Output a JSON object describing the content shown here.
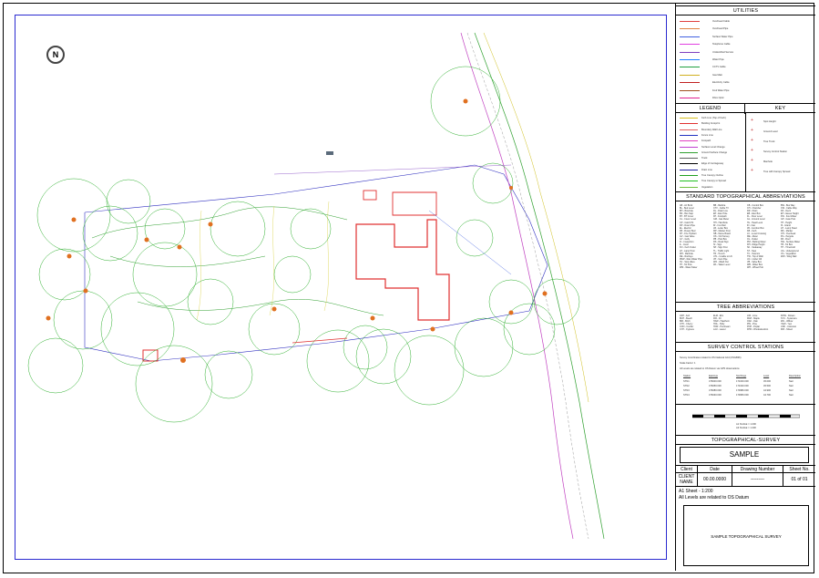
{
  "north_label": "N",
  "panel": {
    "utilities_title": "UTILITIES",
    "utilities": [
      {
        "label": "Overhead Cable",
        "color": "#e04040"
      },
      {
        "label": "Overhead Pipe",
        "color": "#e08040"
      },
      {
        "label": "Surface Water Pipe",
        "color": "#4060e0"
      },
      {
        "label": "Telephone Cable",
        "color": "#e040e0"
      },
      {
        "label": "Unidentified Service",
        "color": "#8040c0"
      },
      {
        "label": "Water Pipe",
        "color": "#2080ff"
      },
      {
        "label": "CCTV Cable",
        "color": "#20a040"
      },
      {
        "label": "Gas Main",
        "color": "#d0b020"
      },
      {
        "label": "Electricity Cable",
        "color": "#c02020"
      },
      {
        "label": "Foul Water Pipe",
        "color": "#a05020"
      },
      {
        "label": "Fibre Optic",
        "color": "#e02090"
      }
    ],
    "legend_title": "LEGEND",
    "key_title": "KEY",
    "legend_items": [
      {
        "label": "Kerb Line (Top of Kerb)",
        "color": "#d8c020"
      },
      {
        "label": "Building Footprint",
        "color": "#e03030"
      },
      {
        "label": "Boundary Wall Line",
        "color": "#e06060"
      },
      {
        "label": "Fence Line",
        "color": "#2030c0"
      },
      {
        "label": "Footpath",
        "color": "#e040c0"
      },
      {
        "label": "Surface Level Change",
        "color": "#c040d0"
      },
      {
        "label": "Ground Surface Change",
        "color": "#30a030"
      },
      {
        "label": "Track",
        "color": "#606060"
      },
      {
        "label": "Edge of Carriageway",
        "color": "#000000"
      },
      {
        "label": "Drain Line",
        "color": "#2020a0"
      },
      {
        "label": "Tree Canopy Outline",
        "color": "#20a020"
      },
      {
        "label": "Tree Canopy to Spread",
        "color": "#20c020"
      },
      {
        "label": "Vegetation",
        "color": "#70c040"
      }
    ],
    "key_items": [
      "Spot Height",
      "Ground Level",
      "Tree Trunk",
      "Survey Control Station",
      "Manhole",
      "Tree with Canopy Spread"
    ],
    "abbrev_title": "STANDARD TOPOGRAPHICAL ABBREVIATIONS",
    "abbrev_cols": [
      [
        "AB - Air Brick",
        "BL - Bed Level",
        "BH - Borehole",
        "BS - Bus Stop",
        "BT - BT Cover",
        "CL - Cover Level",
        "CP - Catch Pit",
        "DP - Down Pipe",
        "EL - Electric",
        "FB - Flower Bed",
        "FH - Fire Hydrant",
        "GV - Gas Valve",
        "GY - Gully",
        "IC - Inspection",
        "IL - Invert",
        "KO - Kerb Outlet",
        "LP - Lamp Post",
        "MH - Manhole",
        "RE - Rod Eye",
        "RWP - Rain Water Pipe",
        "SV - Stop Valve",
        "TP - Tel Pole",
        "WM - Water Meter"
      ],
      [
        "BB - Belisha",
        "CTV - Cable TV",
        "DL - Drain Line",
        "EP - Elec Pole",
        "FP - Footpath",
        "GM - Gas Meter",
        "HH - Handhole",
        "IR - Iron Rail",
        "LB - Letter Box",
        "MP - Marker Post",
        "NB - Name Board",
        "OS - Ord Survey",
        "PB - Post Box",
        "RS - Road Sign",
        "SI - Sign",
        "SP - Sign Post",
        "TL - Traffic Light",
        "TR - Trench",
        "UTL - Unable to Lift",
        "VP - Vent Pipe",
        "WO - Wash Out",
        "WL - Water Level"
      ],
      [
        "CB - Control Box",
        "CH - Chamber",
        "DR - Drain",
        "EB - Elec Box",
        "FL - Floor Level",
        "GL - Ground Level",
        "HL - Head Level",
        "IN - Inlet",
        "JB - Junction Box",
        "KB - Kerb",
        "LC - Level Crossing",
        "ME - Meter",
        "OL - Outlet",
        "PM - Parking Meter",
        "RH - Ridge Height",
        "SK - Soakaway",
        "ST - Step",
        "TC - Telecom",
        "TW - Top of Wall",
        "UC - Under Cill",
        "VB - Valve Box",
        "WB - Water Box",
        "WH - Wheel Hub"
      ],
      [
        "BW - Bus Way",
        "CW - Cable Way",
        "DK - Deck",
        "EH - Eaves Height",
        "FW - Foul Water",
        "GP - Gate Post",
        "HT - Height",
        "IS - Island",
        "LH - Lamp Head",
        "MK - Marker",
        "OH - Overhead",
        "PG - Pergola",
        "RF - Roof",
        "SW - Surface Water",
        "TB - Tel Box",
        "TH - Threshold",
        "UG - Underground",
        "VG - Vegetation",
        "WW - Wing Wall"
      ]
    ],
    "tree_title": "TREE ABBREVIATIONS",
    "tree_cols": [
      [
        "ASH - Ash",
        "BCH - Beech",
        "BIR - Birch",
        "CHY - Cherry",
        "CON - Conifer",
        "CYP - Cypress"
      ],
      [
        "ELM - Elm",
        "FIR - Fir",
        "HAW - Hawthorn",
        "HOL - Holly",
        "HOR - Hornbeam",
        "LAU - Laurel"
      ],
      [
        "LIM - Lime",
        "MAP - Maple",
        "OAK - Oak",
        "PIN - Pine",
        "POP - Poplar",
        "RHO - Rhododendron"
      ],
      [
        "ROW - Rowan",
        "SYC - Sycamore",
        "WIL - Willow",
        "YEW - Yew",
        "UNK - Unknown",
        "MIX - Mixed"
      ]
    ],
    "stations_title": "SURVEY CONTROL STATIONS",
    "stations_notes": [
      "Survey Coordinates related to OS National Grid (OSGB36)",
      "Scale Factor: 1",
      "All Levels are related to OS Datum via GPS observations"
    ],
    "stations_header": [
      "Station",
      "Eastings",
      "Northings",
      "Level",
      "Description"
    ],
    "stations_rows": [
      [
        "STN1",
        "476000.000",
        "171000.000",
        "45.000",
        "Nail"
      ],
      [
        "STN2",
        "476050.000",
        "171020.000",
        "45.500",
        "Nail"
      ],
      [
        "STN3",
        "476080.000",
        "170980.000",
        "44.900",
        "Nail"
      ],
      [
        "STN4",
        "476030.000",
        "170950.000",
        "44.700",
        "Nail"
      ]
    ],
    "scale_caption": "A1 SCALE = 1:200",
    "scale_caption2": "A3 SCALE = 1:400",
    "survey_title": "TOPOGRAPHICAL-SURVEY",
    "sample_label": "SAMPLE",
    "tb_headers": [
      "Client",
      "Date",
      "Drawing Number",
      "Sheet No."
    ],
    "tb_values": [
      "CLIENT NAME",
      "00.00.0000",
      "---------",
      "01 of 01"
    ],
    "sheet_note": "A1 Sheet  -  1:200",
    "levels_note": "All Levels are related to OS Datum",
    "final_label": "SAMPLE TOPOGRAPHICAL SURVEY"
  }
}
